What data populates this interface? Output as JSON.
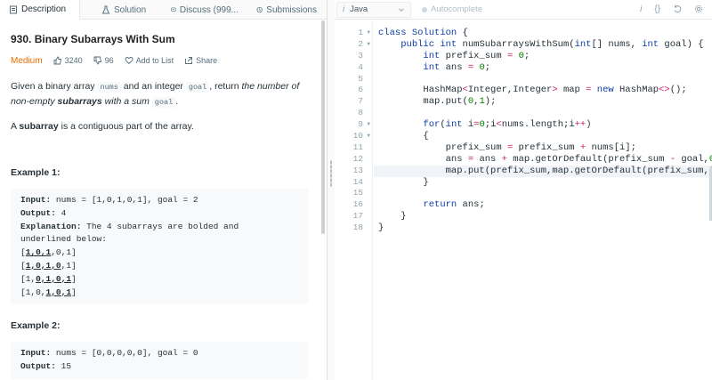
{
  "tabs": [
    {
      "label": "Description",
      "icon": "description-icon"
    },
    {
      "label": "Solution",
      "icon": "flask-icon"
    },
    {
      "label": "Discuss (999...",
      "icon": "discuss-icon"
    },
    {
      "label": "Submissions",
      "icon": "history-icon"
    }
  ],
  "problem": {
    "title": "930. Binary Subarrays With Sum",
    "difficulty": "Medium",
    "difficulty_color": "#ef6c00",
    "likes": "3240",
    "dislikes": "96",
    "add_to_list": "Add to List",
    "share": "Share",
    "desc_1": "Given a binary array ",
    "desc_code1": "nums",
    "desc_2": " and an integer ",
    "desc_code2": "goal",
    "desc_3": ", return ",
    "desc_em1": "the number of non-empty ",
    "desc_em_b": "subarrays",
    "desc_em2": " with a sum ",
    "desc_code3": "goal",
    "desc_4": ".",
    "sub_1": "A ",
    "sub_b": "subarray",
    "sub_2": " is a contiguous part of the array."
  },
  "example1": {
    "title": "Example 1:",
    "input_label": "Input:",
    "input": " nums = [1,0,1,0,1], goal = 2",
    "output_label": "Output:",
    "output": " 4",
    "explanation_label": "Explanation:",
    "explanation": " The 4 subarrays are bolded and",
    "explanation_2": "underlined below:",
    "rows": [
      {
        "pre": "[",
        "u": "1,0,1",
        "post": ",0,1]"
      },
      {
        "pre": "[",
        "u": "1,0,1,0",
        "post": ",1]"
      },
      {
        "pre": "[1,",
        "u": "0,1,0,1",
        "post": "]"
      },
      {
        "pre": "[1,0,",
        "u": "1,0,1",
        "post": "]"
      }
    ]
  },
  "example2": {
    "title": "Example 2:",
    "input_label": "Input:",
    "input": " nums = [0,0,0,0,0], goal = 0",
    "output_label": "Output:",
    "output": " 15"
  },
  "editor": {
    "language": "Java",
    "autocomplete": "Autocomplete",
    "tool_info": "i",
    "tool_braces": "{}",
    "line_numbers": [
      "1",
      "2",
      "3",
      "4",
      "5",
      "6",
      "7",
      "8",
      "9",
      "10",
      "11",
      "12",
      "13",
      "14",
      "15",
      "16",
      "17",
      "18"
    ]
  }
}
